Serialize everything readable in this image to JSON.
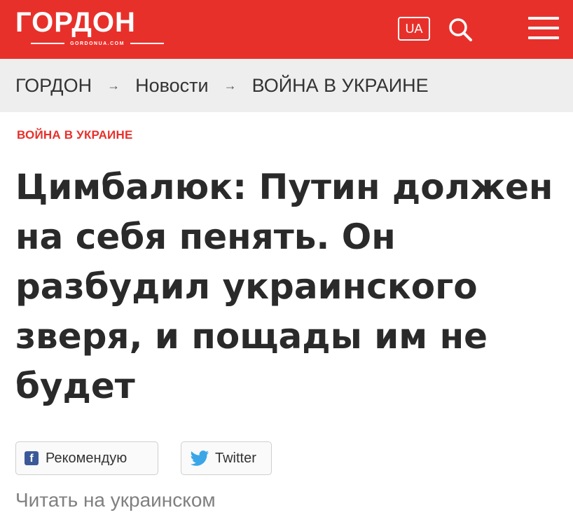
{
  "header": {
    "logo_text": "ГОРДОН",
    "logo_domain": "GORDONUA.COM",
    "lang_label": "UA",
    "search_icon": "search-icon",
    "menu_icon": "hamburger-menu-icon",
    "brand_color": "#e8302b"
  },
  "breadcrumbs": {
    "items": [
      "ГОРДОН",
      "Новости",
      "ВОЙНА В УКРАИНЕ"
    ],
    "separator": "→"
  },
  "article": {
    "section": "ВОЙНА В УКРАИНЕ",
    "title": "Цимбалюк: Путин должен на себя пенять. Он разбудил украинского зверя, и пощады им не будет"
  },
  "share": {
    "recommend_label": "Рекомендую",
    "twitter_label": "Twitter"
  },
  "translate_link": "Читать на украинском"
}
